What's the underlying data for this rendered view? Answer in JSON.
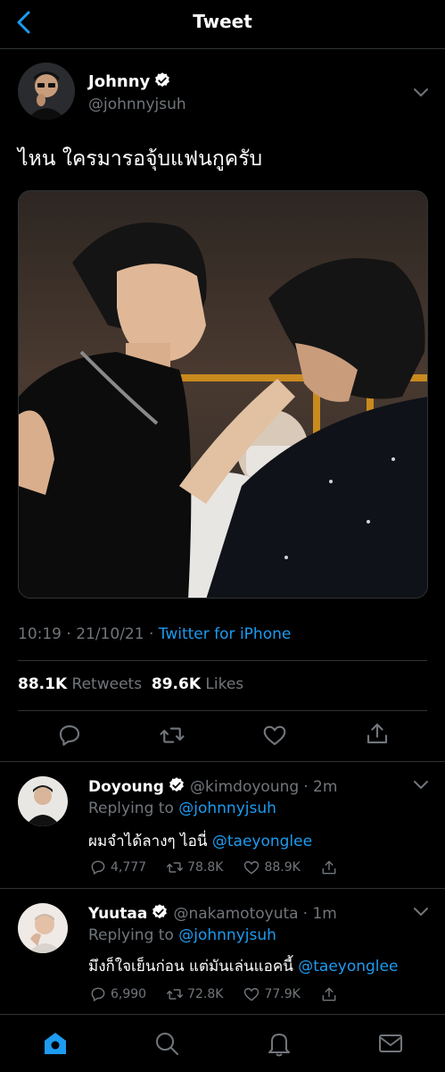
{
  "header": {
    "title": "Tweet"
  },
  "tweet": {
    "author_name": "Johnny",
    "author_handle": "@johnnyjsuh",
    "text": "ไหน ใครมารอจุ้บแฟนกูครับ",
    "time": "10:19 · 21/10/21 ·",
    "source": "Twitter for iPhone",
    "retweets_count": "88.1K",
    "retweets_label": "Retweets",
    "likes_count": "89.6K",
    "likes_label": "Likes"
  },
  "replies": [
    {
      "name": "Doyoung",
      "handle": "@kimdoyoung",
      "time": "· 2m",
      "replying_prefix": "Replying to",
      "replying_to": "@johnnyjsuh",
      "text": "ผมจำได้ลางๆ ไอนี่",
      "mention": "@taeyonglee",
      "reply_count": "4,777",
      "retweet_count": "78.8K",
      "like_count": "88.9K"
    },
    {
      "name": "Yuutaa",
      "handle": "@nakamotoyuta",
      "time": "· 1m",
      "replying_prefix": "Replying to",
      "replying_to": "@johnnyjsuh",
      "text": "มึงก็ใจเย็นก่อน แต่มันเล่นแอคนี้",
      "mention": "@taeyonglee",
      "reply_count": "6,990",
      "retweet_count": "72.8K",
      "like_count": "77.9K"
    }
  ],
  "colors": {
    "accent": "#1d9bf0",
    "muted": "#71767b",
    "background": "#000000",
    "divider": "#2f3336"
  },
  "icons": [
    "back-arrow-icon",
    "verified-badge-icon",
    "chevron-down-icon",
    "reply-icon",
    "retweet-icon",
    "like-icon",
    "share-icon",
    "home-icon",
    "search-icon",
    "notifications-icon",
    "messages-icon"
  ]
}
